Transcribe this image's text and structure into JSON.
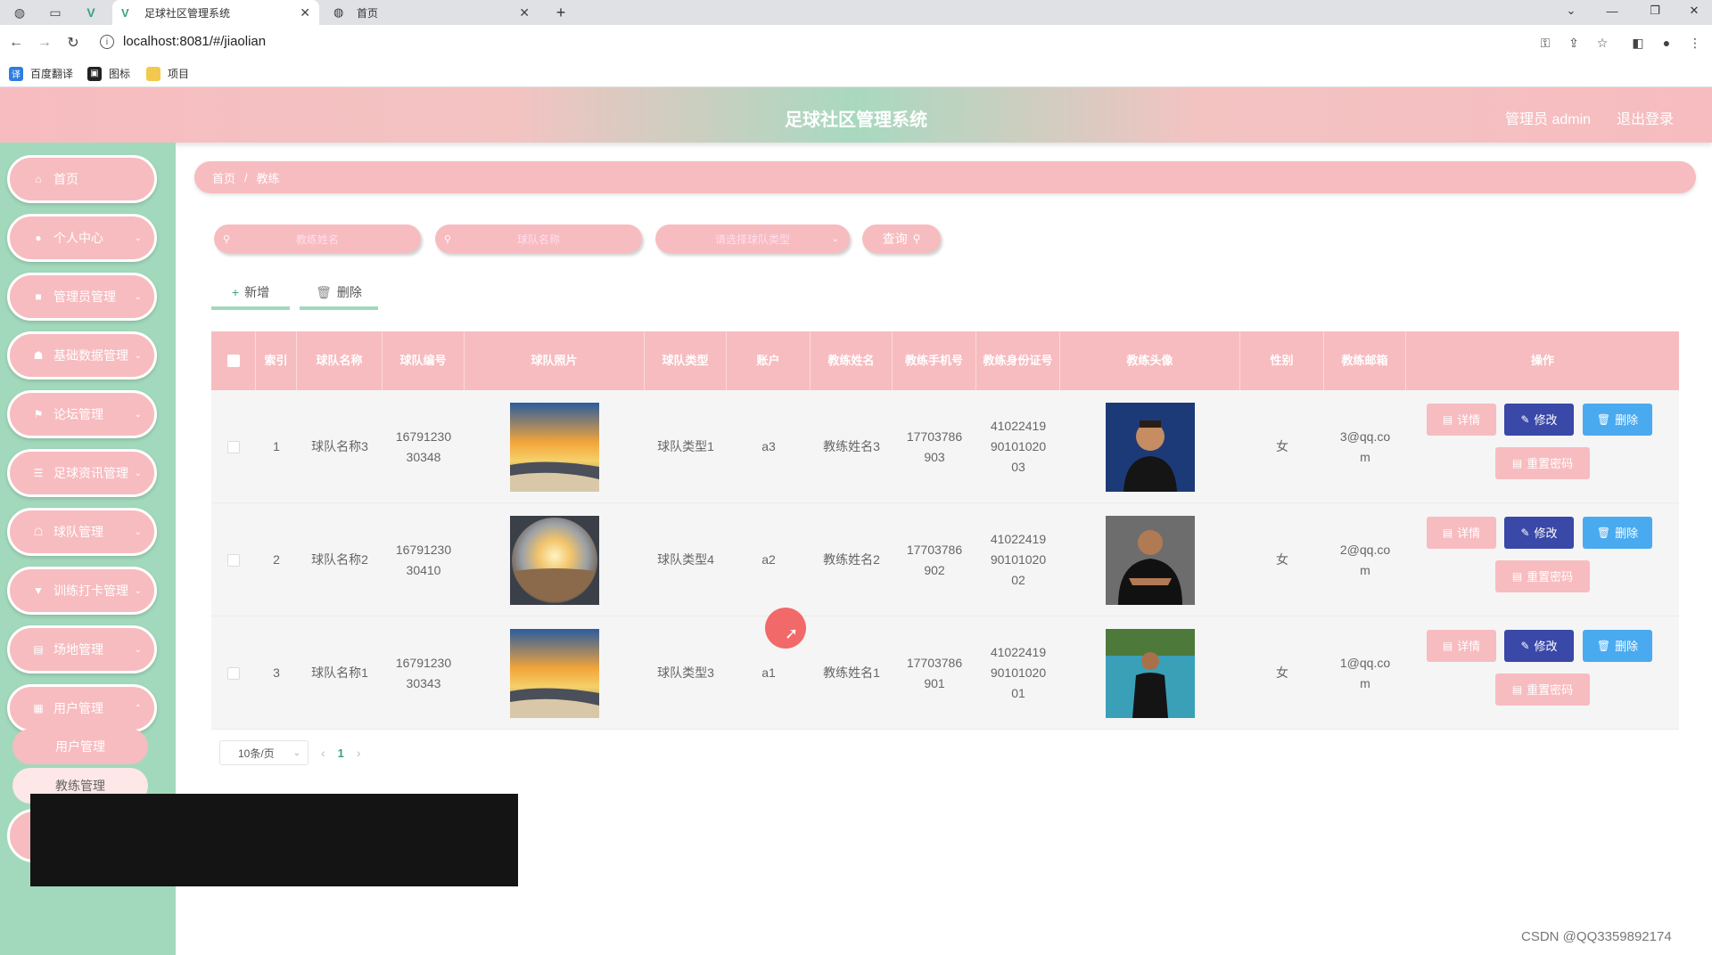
{
  "browser": {
    "tabs": [
      {
        "label": "足球社区管理系统",
        "icon": "vue-icon",
        "active": true
      },
      {
        "label": "首页",
        "icon": "globe-icon",
        "active": false
      }
    ],
    "url": "localhost:8081/#/jiaolian",
    "bookmarks": [
      {
        "label": "百度翻译",
        "icon": "translate-icon",
        "color": "#2f7de1"
      },
      {
        "label": "图标",
        "icon": "picture-icon",
        "color": "#222222"
      },
      {
        "label": "项目",
        "icon": "folder-icon",
        "color": "#f2c94c"
      }
    ]
  },
  "header": {
    "title": "足球社区管理系统",
    "admin": "管理员 admin",
    "logout": "退出登录"
  },
  "sidebar": {
    "items": [
      {
        "label": "首页",
        "icon": "home-icon",
        "has_children": false
      },
      {
        "label": "个人中心",
        "icon": "user-icon",
        "has_children": true
      },
      {
        "label": "管理员管理",
        "icon": "admin-icon",
        "has_children": true
      },
      {
        "label": "基础数据管理",
        "icon": "data-icon",
        "has_children": true
      },
      {
        "label": "论坛管理",
        "icon": "flag-icon",
        "has_children": true
      },
      {
        "label": "足球资讯管理",
        "icon": "news-icon",
        "has_children": true
      },
      {
        "label": "球队管理",
        "icon": "team-icon",
        "has_children": true
      },
      {
        "label": "训练打卡管理",
        "icon": "checkin-icon",
        "has_children": true
      },
      {
        "label": "场地管理",
        "icon": "venue-icon",
        "has_children": true
      },
      {
        "label": "用户管理",
        "icon": "grid-icon",
        "has_children": true
      }
    ],
    "submenu": [
      "用户管理",
      "教练管理"
    ]
  },
  "breadcrumb": [
    "首页",
    "教练"
  ],
  "search": {
    "field1_placeholder": "教练姓名",
    "field2_placeholder": "球队名称",
    "select_placeholder": "请选择球队类型",
    "query_label": "查询"
  },
  "actions": {
    "add_label": "新增",
    "delete_label": "删除"
  },
  "table": {
    "headers": [
      "索引",
      "球队名称",
      "球队编号",
      "球队照片",
      "球队类型",
      "账户",
      "教练姓名",
      "教练手机号",
      "教练身份证号",
      "教练头像",
      "性别",
      "教练邮箱",
      "操作"
    ],
    "rows": [
      {
        "index": "1",
        "team_name": "球队名称3",
        "team_no": "1679123030348",
        "team_photo": "sunset-beach",
        "team_type": "球队类型1",
        "account": "a3",
        "coach_name": "教练姓名3",
        "coach_phone": "17703786903",
        "coach_id": "410224199010102003",
        "coach_avatar": "coach-3",
        "gender": "女",
        "email": "3@qq.com"
      },
      {
        "index": "2",
        "team_name": "球队名称2",
        "team_no": "1679123030410",
        "team_photo": "sunset-round",
        "team_type": "球队类型4",
        "account": "a2",
        "coach_name": "教练姓名2",
        "coach_phone": "17703786902",
        "coach_id": "410224199010102002",
        "coach_avatar": "coach-2",
        "gender": "女",
        "email": "2@qq.com"
      },
      {
        "index": "3",
        "team_name": "球队名称1",
        "team_no": "1679123030343",
        "team_photo": "sunset-beach",
        "team_type": "球队类型3",
        "account": "a1",
        "coach_name": "教练姓名1",
        "coach_phone": "17703786901",
        "coach_id": "410224199010102001",
        "coach_avatar": "coach-1",
        "gender": "女",
        "email": "1@qq.com"
      }
    ],
    "row_buttons": {
      "detail": "详情",
      "edit": "修改",
      "delete": "删除",
      "reset": "重置密码"
    }
  },
  "pagination": {
    "page_size": "10条/页",
    "current_page": "1"
  },
  "watermark": "CSDN @QQ3359892174",
  "colors": {
    "pink": "#f7bcc0",
    "green": "#a2d9bc",
    "edit_blue": "#3a48a8",
    "delete_blue": "#4aaaf0"
  }
}
